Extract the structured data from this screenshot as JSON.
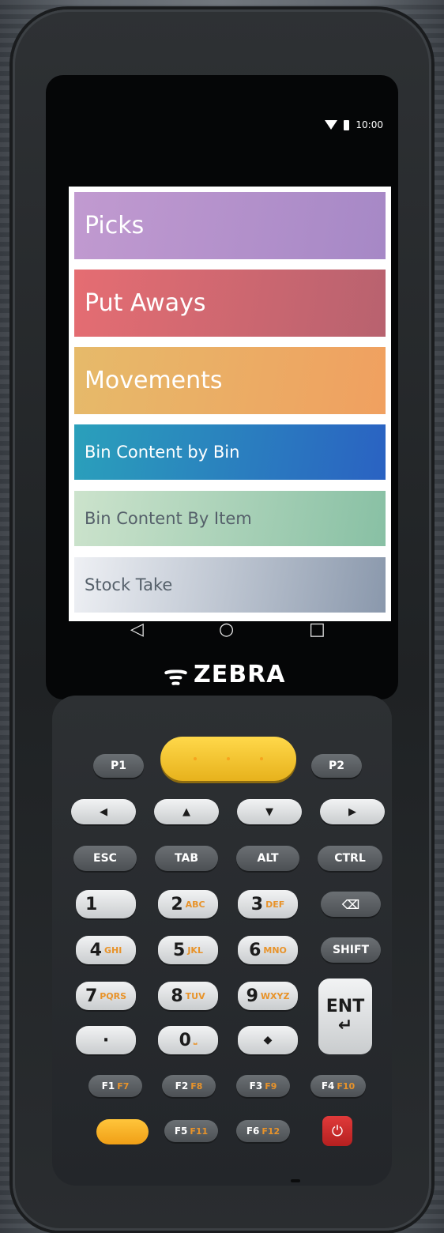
{
  "status": {
    "time": "10:00",
    "wifi_icon": "wifi-icon",
    "battery_icon": "battery-icon"
  },
  "menu": {
    "items": [
      {
        "label": "Picks",
        "colors": [
          "#c19ad0",
          "#a688c6"
        ]
      },
      {
        "label": "Put Aways",
        "colors": [
          "#e56d72",
          "#b8626f"
        ]
      },
      {
        "label": "Movements",
        "colors": [
          "#e6ba6a",
          "#f0a060"
        ]
      },
      {
        "label": "Bin Content by Bin",
        "colors": [
          "#2aa0bb",
          "#2a62c2"
        ]
      },
      {
        "label": "Bin Content By Item",
        "colors": [
          "#cce3cc",
          "#88c0a4"
        ]
      },
      {
        "label": "Stock Take",
        "colors": [
          "#eef0f4",
          "#8a98ac"
        ]
      }
    ]
  },
  "nav": {
    "back": "◁",
    "home": "○",
    "recents": "□"
  },
  "brand": {
    "mark": "ᯤ",
    "name": "ZEBRA"
  },
  "keys": {
    "p1": "P1",
    "p2": "P2",
    "left": "◀",
    "up": "▲",
    "down": "▼",
    "right": "▶",
    "esc": "ESC",
    "tab": "TAB",
    "alt": "ALT",
    "ctrl": "CTRL",
    "k1": "1",
    "k2": "2",
    "k2s": "ABC",
    "k3": "3",
    "k3s": "DEF",
    "bksp": "⌫",
    "k4": "4",
    "k4s": "GHI",
    "k5": "5",
    "k5s": "JKL",
    "k6": "6",
    "k6s": "MNO",
    "shift": "SHIFT",
    "k7": "7",
    "k7s": "PQRS",
    "k8": "8",
    "k8s": "TUV",
    "k9": "9",
    "k9s": "WXYZ",
    "dot": "·",
    "k0": "0",
    "k0s": "⎵",
    "diamond": "◆",
    "ent": "ENT",
    "ent_arrow": "↵",
    "f1": "F1",
    "f7": "F7",
    "f2": "F2",
    "f8": "F8",
    "f3": "F3",
    "f9": "F9",
    "f4": "F4",
    "f10": "F10",
    "f5": "F5",
    "f11": "F11",
    "f6": "F6",
    "f12": "F12",
    "power": "⏻"
  }
}
